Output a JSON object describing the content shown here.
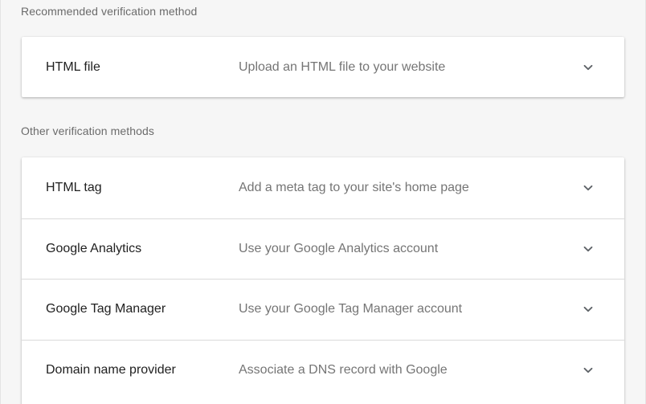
{
  "recommended": {
    "heading": "Recommended verification method",
    "methods": [
      {
        "name": "HTML file",
        "description": "Upload an HTML file to your website",
        "icon": "chevron-down-icon"
      }
    ]
  },
  "other": {
    "heading": "Other verification methods",
    "methods": [
      {
        "name": "HTML tag",
        "description": "Add a meta tag to your site's home page",
        "icon": "chevron-down-icon"
      },
      {
        "name": "Google Analytics",
        "description": "Use your Google Analytics account",
        "icon": "chevron-down-icon"
      },
      {
        "name": "Google Tag Manager",
        "description": "Use your Google Tag Manager account",
        "icon": "chevron-down-icon"
      },
      {
        "name": "Domain name provider",
        "description": "Associate a DNS record with Google",
        "icon": "chevron-down-icon"
      }
    ]
  },
  "colors": {
    "background": "#f6f6f6",
    "card": "#ffffff",
    "primary_text": "#212121",
    "secondary_text": "#757575",
    "divider": "#dadada"
  }
}
